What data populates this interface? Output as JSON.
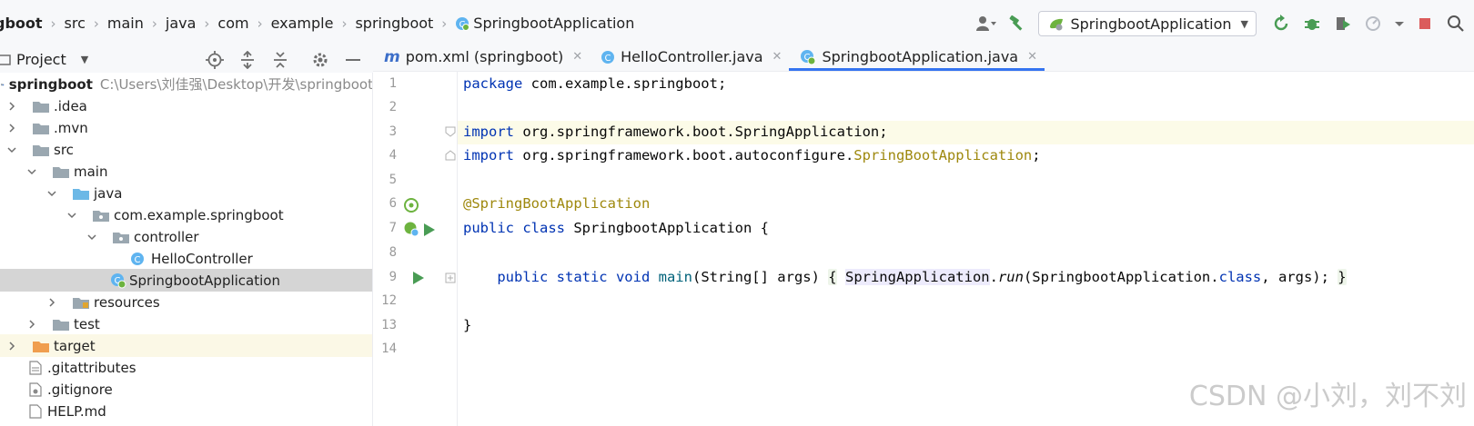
{
  "breadcrumb": [
    "gboot",
    "src",
    "main",
    "java",
    "com",
    "example",
    "springboot",
    "SpringbootApplication"
  ],
  "run_config": {
    "label": "SpringbootApplication"
  },
  "project_panel": {
    "title": "Project"
  },
  "tree": [
    {
      "label": "springboot",
      "path": "C:\\Users\\刘佳强\\Desktop\\开发\\springboot"
    },
    {
      "label": ".idea"
    },
    {
      "label": ".mvn"
    },
    {
      "label": "src"
    },
    {
      "label": "main"
    },
    {
      "label": "java"
    },
    {
      "label": "com.example.springboot"
    },
    {
      "label": "controller"
    },
    {
      "label": "HelloController"
    },
    {
      "label": "SpringbootApplication"
    },
    {
      "label": "resources"
    },
    {
      "label": "test"
    },
    {
      "label": "target"
    },
    {
      "label": ".gitattributes"
    },
    {
      "label": ".gitignore"
    },
    {
      "label": "HELP.md"
    }
  ],
  "tabs": [
    {
      "label": "pom.xml (springboot)",
      "icon": "m"
    },
    {
      "label": "HelloController.java",
      "icon": "C"
    },
    {
      "label": "SpringbootApplication.java",
      "icon": "C"
    }
  ],
  "line_numbers": [
    "1",
    "2",
    "3",
    "4",
    "5",
    "6",
    "7",
    "8",
    "9",
    "12",
    "13",
    "14"
  ],
  "code": {
    "l1_kw": "package",
    "l1_rest": " com.example.springboot;",
    "l3_kw": "import",
    "l3_rest": " org.springframework.boot.SpringApplication;",
    "l4_kw": "import",
    "l4_rest": " org.springframework.boot.autoconfigure.",
    "l4_anno": "SpringBootApplication",
    "l4_end": ";",
    "l6_anno": "@SpringBootApplication",
    "l7_kw": "public class",
    "l7_rest": " SpringbootApplication {",
    "l9_indent": "    ",
    "l9_kw": "public static void",
    "l9_fn": " main",
    "l9_args": "(String[] args) ",
    "l9_ob": "{",
    "l9_sp": " ",
    "l9_cls": "SpringApplication",
    "l9_dot": ".",
    "l9_run": "run",
    "l9_call": "(SpringbootApplication.",
    "l9_class": "class",
    "l9_tail": ", args); ",
    "l9_cb": "}",
    "l13": "}"
  },
  "watermark": "CSDN @小刘，刘不刘",
  "colors": {
    "accent": "#3574f0",
    "keyword": "#0033b3",
    "annotation": "#9e880d",
    "run_green": "#499c54",
    "stop_red": "#db5c5c"
  }
}
